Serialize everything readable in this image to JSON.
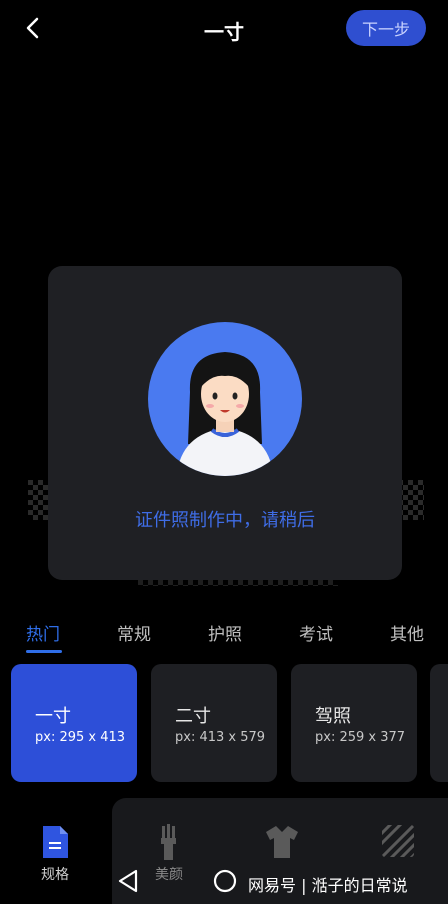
{
  "header": {
    "title": "一寸",
    "next_label": "下一步"
  },
  "dialog": {
    "message": "证件照制作中，请稍后"
  },
  "tabs": [
    {
      "label": "热门",
      "active": true
    },
    {
      "label": "常规",
      "active": false
    },
    {
      "label": "护照",
      "active": false
    },
    {
      "label": "考试",
      "active": false
    },
    {
      "label": "其他",
      "active": false
    }
  ],
  "cards": [
    {
      "name": "一寸",
      "size": "px: 295 x 413",
      "selected": true
    },
    {
      "name": "二寸",
      "size": "px: 413 x 579",
      "selected": false
    },
    {
      "name": "驾照",
      "size": "px: 259 x 377",
      "selected": false
    }
  ],
  "bottom_nav": [
    {
      "label": "规格",
      "icon": "document-icon"
    },
    {
      "label": "美颜",
      "icon": "brush-icon"
    },
    {
      "label": "",
      "icon": "shirt-icon"
    },
    {
      "label": "",
      "icon": "background-pattern-icon"
    }
  ],
  "watermark": "网易号 | 湉子的日常说",
  "colors": {
    "accent": "#2f6ee8",
    "selected_card": "#2d4fd8",
    "dialog_bg": "#1f2024",
    "avatar_bg": "#4a7af0"
  }
}
